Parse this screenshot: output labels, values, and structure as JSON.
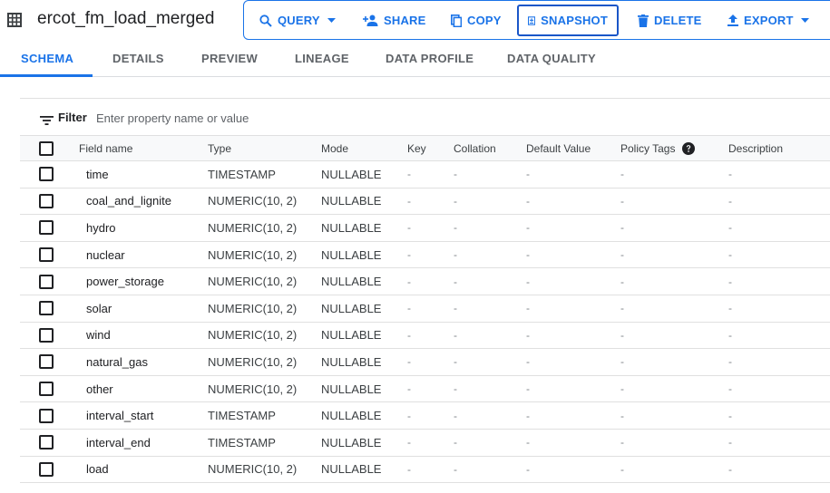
{
  "header": {
    "title": "ercot_fm_load_merged",
    "icon": "table-grid-icon"
  },
  "toolbar": {
    "query_label": "QUERY",
    "share_label": "SHARE",
    "copy_label": "COPY",
    "snapshot_label": "SNAPSHOT",
    "delete_label": "DELETE",
    "export_label": "EXPORT"
  },
  "tabs": [
    {
      "label": "SCHEMA",
      "active": true
    },
    {
      "label": "DETAILS",
      "active": false
    },
    {
      "label": "PREVIEW",
      "active": false
    },
    {
      "label": "LINEAGE",
      "active": false
    },
    {
      "label": "DATA PROFILE",
      "active": false
    },
    {
      "label": "DATA QUALITY",
      "active": false
    }
  ],
  "filter": {
    "label": "Filter",
    "placeholder": "Enter property name or value"
  },
  "table": {
    "columns": {
      "name": "Field name",
      "type": "Type",
      "mode": "Mode",
      "key": "Key",
      "collation": "Collation",
      "default": "Default Value",
      "policy": "Policy Tags",
      "description": "Description"
    },
    "rows": [
      {
        "name": "time",
        "type": "TIMESTAMP",
        "mode": "NULLABLE",
        "key": "-",
        "collation": "-",
        "default": "-",
        "policy": "-",
        "description": "-"
      },
      {
        "name": "coal_and_lignite",
        "type": "NUMERIC(10, 2)",
        "mode": "NULLABLE",
        "key": "-",
        "collation": "-",
        "default": "-",
        "policy": "-",
        "description": "-"
      },
      {
        "name": "hydro",
        "type": "NUMERIC(10, 2)",
        "mode": "NULLABLE",
        "key": "-",
        "collation": "-",
        "default": "-",
        "policy": "-",
        "description": "-"
      },
      {
        "name": "nuclear",
        "type": "NUMERIC(10, 2)",
        "mode": "NULLABLE",
        "key": "-",
        "collation": "-",
        "default": "-",
        "policy": "-",
        "description": "-"
      },
      {
        "name": "power_storage",
        "type": "NUMERIC(10, 2)",
        "mode": "NULLABLE",
        "key": "-",
        "collation": "-",
        "default": "-",
        "policy": "-",
        "description": "-"
      },
      {
        "name": "solar",
        "type": "NUMERIC(10, 2)",
        "mode": "NULLABLE",
        "key": "-",
        "collation": "-",
        "default": "-",
        "policy": "-",
        "description": "-"
      },
      {
        "name": "wind",
        "type": "NUMERIC(10, 2)",
        "mode": "NULLABLE",
        "key": "-",
        "collation": "-",
        "default": "-",
        "policy": "-",
        "description": "-"
      },
      {
        "name": "natural_gas",
        "type": "NUMERIC(10, 2)",
        "mode": "NULLABLE",
        "key": "-",
        "collation": "-",
        "default": "-",
        "policy": "-",
        "description": "-"
      },
      {
        "name": "other",
        "type": "NUMERIC(10, 2)",
        "mode": "NULLABLE",
        "key": "-",
        "collation": "-",
        "default": "-",
        "policy": "-",
        "description": "-"
      },
      {
        "name": "interval_start",
        "type": "TIMESTAMP",
        "mode": "NULLABLE",
        "key": "-",
        "collation": "-",
        "default": "-",
        "policy": "-",
        "description": "-"
      },
      {
        "name": "interval_end",
        "type": "TIMESTAMP",
        "mode": "NULLABLE",
        "key": "-",
        "collation": "-",
        "default": "-",
        "policy": "-",
        "description": "-"
      },
      {
        "name": "load",
        "type": "NUMERIC(10, 2)",
        "mode": "NULLABLE",
        "key": "-",
        "collation": "-",
        "default": "-",
        "policy": "-",
        "description": "-"
      }
    ]
  },
  "colors": {
    "accent": "#1a73e8",
    "border": "#e0e0e0",
    "header_bg": "#f8f9fa"
  }
}
